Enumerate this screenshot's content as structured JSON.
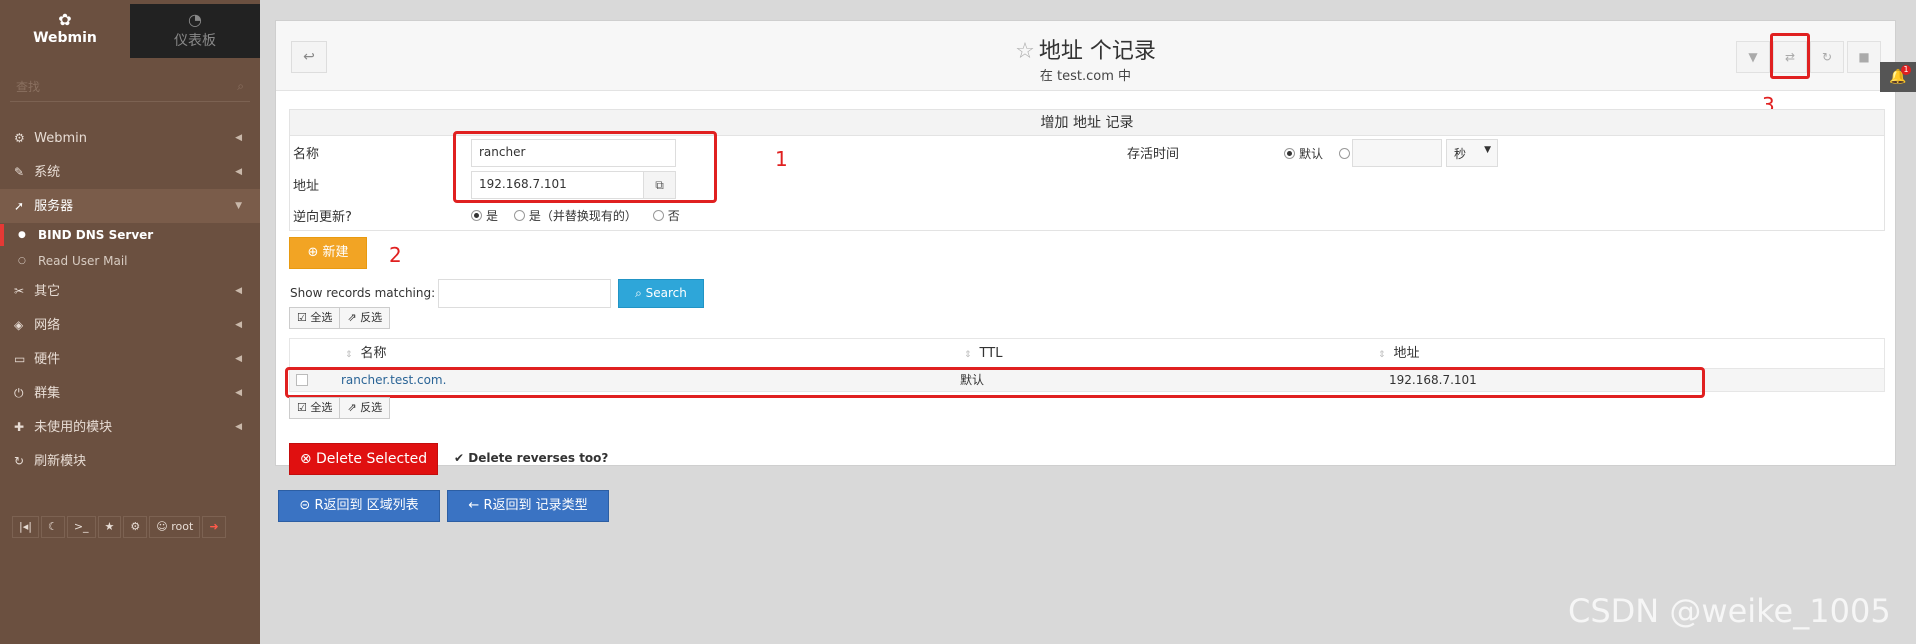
{
  "sidebar": {
    "tabs": {
      "webmin": "Webmin",
      "dashboard": "仪表板"
    },
    "search_placeholder": "查找",
    "items": [
      {
        "label": "Webmin",
        "icon": "gear-icon"
      },
      {
        "label": "系统",
        "icon": "wrench-icon"
      },
      {
        "label": "服务器",
        "icon": "rocket-icon"
      },
      {
        "label": "其它",
        "icon": "tools-icon"
      },
      {
        "label": "网络",
        "icon": "shield-icon"
      },
      {
        "label": "硬件",
        "icon": "hdd-icon"
      },
      {
        "label": "群集",
        "icon": "power-icon"
      },
      {
        "label": "未使用的模块",
        "icon": "puzzle-icon"
      },
      {
        "label": "刷新模块",
        "icon": "refresh-icon"
      }
    ],
    "sub_items": [
      {
        "label": "BIND DNS Server"
      },
      {
        "label": "Read User Mail"
      }
    ],
    "bottom_user": "root"
  },
  "header": {
    "title": "地址 个记录",
    "subtitle": "在 test.com 中"
  },
  "form": {
    "heading": "增加 地址 记录",
    "name_label": "名称",
    "name_value": "rancher",
    "address_label": "地址",
    "address_value": "192.168.7.101",
    "ttl_label": "存活时间",
    "ttl_default": "默认",
    "ttl_unit": "秒",
    "reverse_label": "逆向更新?",
    "reverse_yes": "是",
    "reverse_yes_replace": "是（并替换现有的）",
    "reverse_no": "否",
    "new_button": "新建"
  },
  "search": {
    "label": "Show records matching:",
    "button": "Search"
  },
  "selection": {
    "all": "全选",
    "invert": "反选"
  },
  "table": {
    "columns": [
      "名称",
      "TTL",
      "地址"
    ],
    "rows": [
      {
        "name": "rancher.test.com.",
        "ttl": "默认",
        "address": "192.168.7.101"
      }
    ]
  },
  "actions": {
    "delete_selected": "Delete Selected",
    "delete_reverses": "Delete reverses too?",
    "back_zones": "R返回到 区域列表",
    "back_types": "R返回到 记录类型"
  },
  "annotations": {
    "one": "1",
    "two": "2",
    "three": "3"
  },
  "notification_count": "1",
  "watermark": "CSDN @weike_1005"
}
